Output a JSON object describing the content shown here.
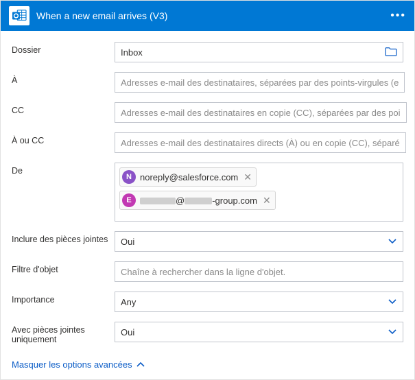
{
  "header": {
    "title": "When a new email arrives (V3)"
  },
  "fields": {
    "dossier": {
      "label": "Dossier",
      "value": "Inbox"
    },
    "a": {
      "label": "À",
      "placeholder": "Adresses e-mail des destinataires, séparées par des points-virgules (e"
    },
    "cc": {
      "label": "CC",
      "placeholder": "Adresses e-mail des destinataires en copie (CC), séparées par des poi"
    },
    "a_ou_cc": {
      "label": "À ou CC",
      "placeholder": "Adresses e-mail des destinataires directs (À) ou en copie (CC), séparé"
    },
    "de": {
      "label": "De",
      "chips": [
        {
          "initial": "N",
          "color": "#8a52c7",
          "email": "noreply@salesforce.com",
          "redacted": false
        },
        {
          "initial": "E",
          "color": "#c239b3",
          "email_suffix": "-group.com",
          "redacted": true
        }
      ]
    },
    "inclure": {
      "label": "Inclure des pièces jointes",
      "value": "Oui"
    },
    "filtre": {
      "label": "Filtre d'objet",
      "placeholder": "Chaîne à rechercher dans la ligne d'objet."
    },
    "importance": {
      "label": "Importance",
      "value": "Any"
    },
    "avec": {
      "label": "Avec pièces jointes uniquement",
      "value": "Oui"
    }
  },
  "advanced_link": "Masquer les options avancées"
}
